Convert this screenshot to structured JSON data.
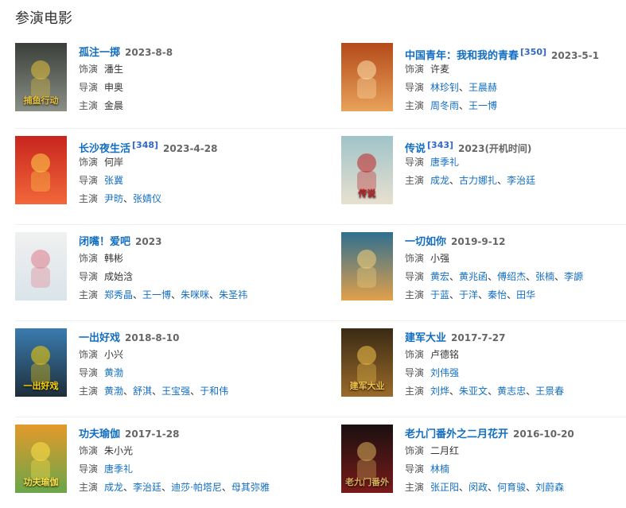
{
  "section_title": "参演电影",
  "labels": {
    "role": "饰演",
    "director": "导演",
    "cast": "主演"
  },
  "films": [
    {
      "title": "孤注一掷",
      "ref": "",
      "date": "2023-8-8",
      "role": "潘生",
      "director": [
        "申奥"
      ],
      "cast": [
        "金晨"
      ],
      "director_links": false,
      "cast_links": false,
      "poster_caption": "捕鱼行动"
    },
    {
      "title": "中国青年：我和我的青春",
      "ref": "[350]",
      "date": "2023-5-1",
      "role": "许麦",
      "director": [
        "林珍钊",
        "王晨赫"
      ],
      "cast": [
        "周冬雨",
        "王一博"
      ],
      "director_links": true,
      "cast_links": true,
      "poster_caption": ""
    },
    {
      "title": "长沙夜生活",
      "ref": "[348]",
      "date": "2023-4-28",
      "role": "何岸",
      "director": [
        "张冀"
      ],
      "cast": [
        "尹昉",
        "张婧仪"
      ],
      "director_links": true,
      "cast_links": true,
      "poster_caption": ""
    },
    {
      "title": "传说",
      "ref": "[343]",
      "date": "2023(开机时间)",
      "role": "",
      "director": [
        "唐季礼"
      ],
      "cast": [
        "成龙",
        "古力娜扎",
        "李治廷"
      ],
      "director_links": true,
      "cast_links": true,
      "poster_caption": "传说"
    },
    {
      "title": "闭嘴！爱吧",
      "ref": "",
      "date": "2023",
      "role": "韩彬",
      "director": [
        "成始浛"
      ],
      "cast": [
        "郑秀晶",
        "王一博",
        "朱咪咪",
        "朱圣祎"
      ],
      "director_links": false,
      "cast_links": true,
      "poster_caption": ""
    },
    {
      "title": "一切如你",
      "ref": "",
      "date": "2019-9-12",
      "role": "小强",
      "director": [
        "黄宏",
        "黄兆函",
        "傅绍杰",
        "张楠",
        "李謜"
      ],
      "cast": [
        "于蓝",
        "于洋",
        "秦怡",
        "田华"
      ],
      "director_links": true,
      "cast_links": true,
      "poster_caption": ""
    },
    {
      "title": "一出好戏",
      "ref": "",
      "date": "2018-8-10",
      "role": "小兴",
      "director": [
        "黄渤"
      ],
      "cast": [
        "黄渤",
        "舒淇",
        "王宝强",
        "于和伟"
      ],
      "director_links": true,
      "cast_links": true,
      "poster_caption": "一出好戏"
    },
    {
      "title": "建军大业",
      "ref": "",
      "date": "2017-7-27",
      "role": "卢德铭",
      "director": [
        "刘伟强"
      ],
      "cast": [
        "刘烨",
        "朱亚文",
        "黄志忠",
        "王景春"
      ],
      "director_links": true,
      "cast_links": true,
      "poster_caption": "建军大业"
    },
    {
      "title": "功夫瑜伽",
      "ref": "",
      "date": "2017-1-28",
      "role": "朱小光",
      "director": [
        "唐季礼"
      ],
      "cast": [
        "成龙",
        "李治廷",
        "迪莎·帕塔尼",
        "母其弥雅"
      ],
      "director_links": true,
      "cast_links": true,
      "poster_caption": "功夫瑜伽"
    },
    {
      "title": "老九门番外之二月花开",
      "ref": "",
      "date": "2016-10-20",
      "role": "二月红",
      "director": [
        "林楠"
      ],
      "cast": [
        "张正阳",
        "闵政",
        "何育骏",
        "刘蔚森"
      ],
      "director_links": true,
      "cast_links": true,
      "poster_caption": "老九门番外"
    }
  ]
}
